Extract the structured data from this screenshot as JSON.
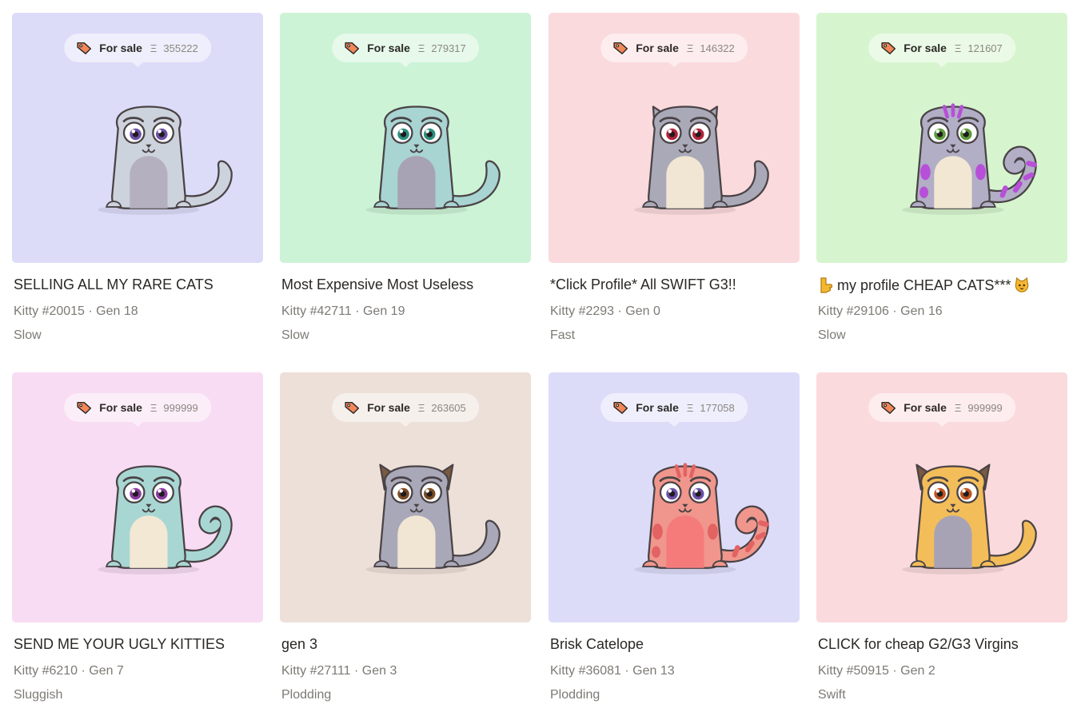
{
  "eth_symbol": "Ξ",
  "for_sale_label": "For sale",
  "kitties": [
    {
      "sale_label": "For sale",
      "eth": "Ξ",
      "price": "355222",
      "title": "SELLING ALL MY RARE CATS",
      "meta": "Kitty #20015 · Gen 18",
      "speed": "Slow",
      "bg": "#dcdcf9",
      "body": "#cdd3dc",
      "belly": "#b4b0c0",
      "eye": "#6b4fa6",
      "tail": "fluffy",
      "ears": "none",
      "spots": "none"
    },
    {
      "sale_label": "For sale",
      "eth": "Ξ",
      "price": "279317",
      "title": "Most Expensive Most Useless",
      "meta": "Kitty #42711 · Gen 19",
      "speed": "Slow",
      "bg": "#ccf3d6",
      "body": "#a8d4d2",
      "belly": "#a7a3b5",
      "eye": "#2a8e7d",
      "tail": "fluffy",
      "ears": "none",
      "spots": "none"
    },
    {
      "sale_label": "For sale",
      "eth": "Ξ",
      "price": "146322",
      "title": "*Click Profile* All SWIFT G3!!",
      "meta": "Kitty #2293 · Gen 0",
      "speed": "Fast",
      "bg": "#fadadd",
      "body": "#a9a9b8",
      "belly": "#f1e6d3",
      "eye": "#b2233a",
      "tail": "fluffy",
      "ears": "grey",
      "spots": "none"
    },
    {
      "sale_label": "For sale",
      "eth": "Ξ",
      "price": "121607",
      "title": "my profile CHEAP CATS***",
      "meta": "Kitty #29106 · Gen 16",
      "speed": "Slow",
      "bg": "#d6f5cf",
      "body": "#b1aec6",
      "belly": "#f2e7d3",
      "eye": "#5c9a3a",
      "tail": "curl",
      "ears": "none",
      "spots": "#b84fd8"
    },
    {
      "sale_label": "For sale",
      "eth": "Ξ",
      "price": "999999",
      "title": "SEND ME YOUR UGLY KITTIES",
      "meta": "Kitty #6210 · Gen 7",
      "speed": "Sluggish",
      "bg": "#f8dcf3",
      "body": "#a8d7d3",
      "belly": "#f2e8d4",
      "eye": "#8a3aa0",
      "tail": "curl",
      "ears": "none",
      "spots": "none"
    },
    {
      "sale_label": "For sale",
      "eth": "Ξ",
      "price": "263605",
      "title": "gen 3",
      "meta": "Kitty #27111 · Gen 3",
      "speed": "Plodding",
      "bg": "#ede0d8",
      "body": "#a9a8b9",
      "belly": "#f1e6d3",
      "eye": "#7a4a22",
      "tail": "fluffy",
      "ears": "brown",
      "spots": "none"
    },
    {
      "sale_label": "For sale",
      "eth": "Ξ",
      "price": "177058",
      "title": "Brisk Catelope",
      "meta": "Kitty #36081 · Gen 13",
      "speed": "Plodding",
      "bg": "#dcdcf9",
      "body": "#f0968c",
      "belly": "#f57b7b",
      "eye": "#6b4fa6",
      "tail": "curl",
      "ears": "none",
      "spots": "#e36262"
    },
    {
      "sale_label": "For sale",
      "eth": "Ξ",
      "price": "999999",
      "title": "CLICK for cheap G2/G3 Virgins",
      "meta": "Kitty #50915 · Gen 2",
      "speed": "Swift",
      "bg": "#fadadd",
      "body": "#f3bd5a",
      "belly": "#a7a3b5",
      "eye": "#c0531e",
      "tail": "fluffy",
      "ears": "brown",
      "spots": "none"
    }
  ]
}
